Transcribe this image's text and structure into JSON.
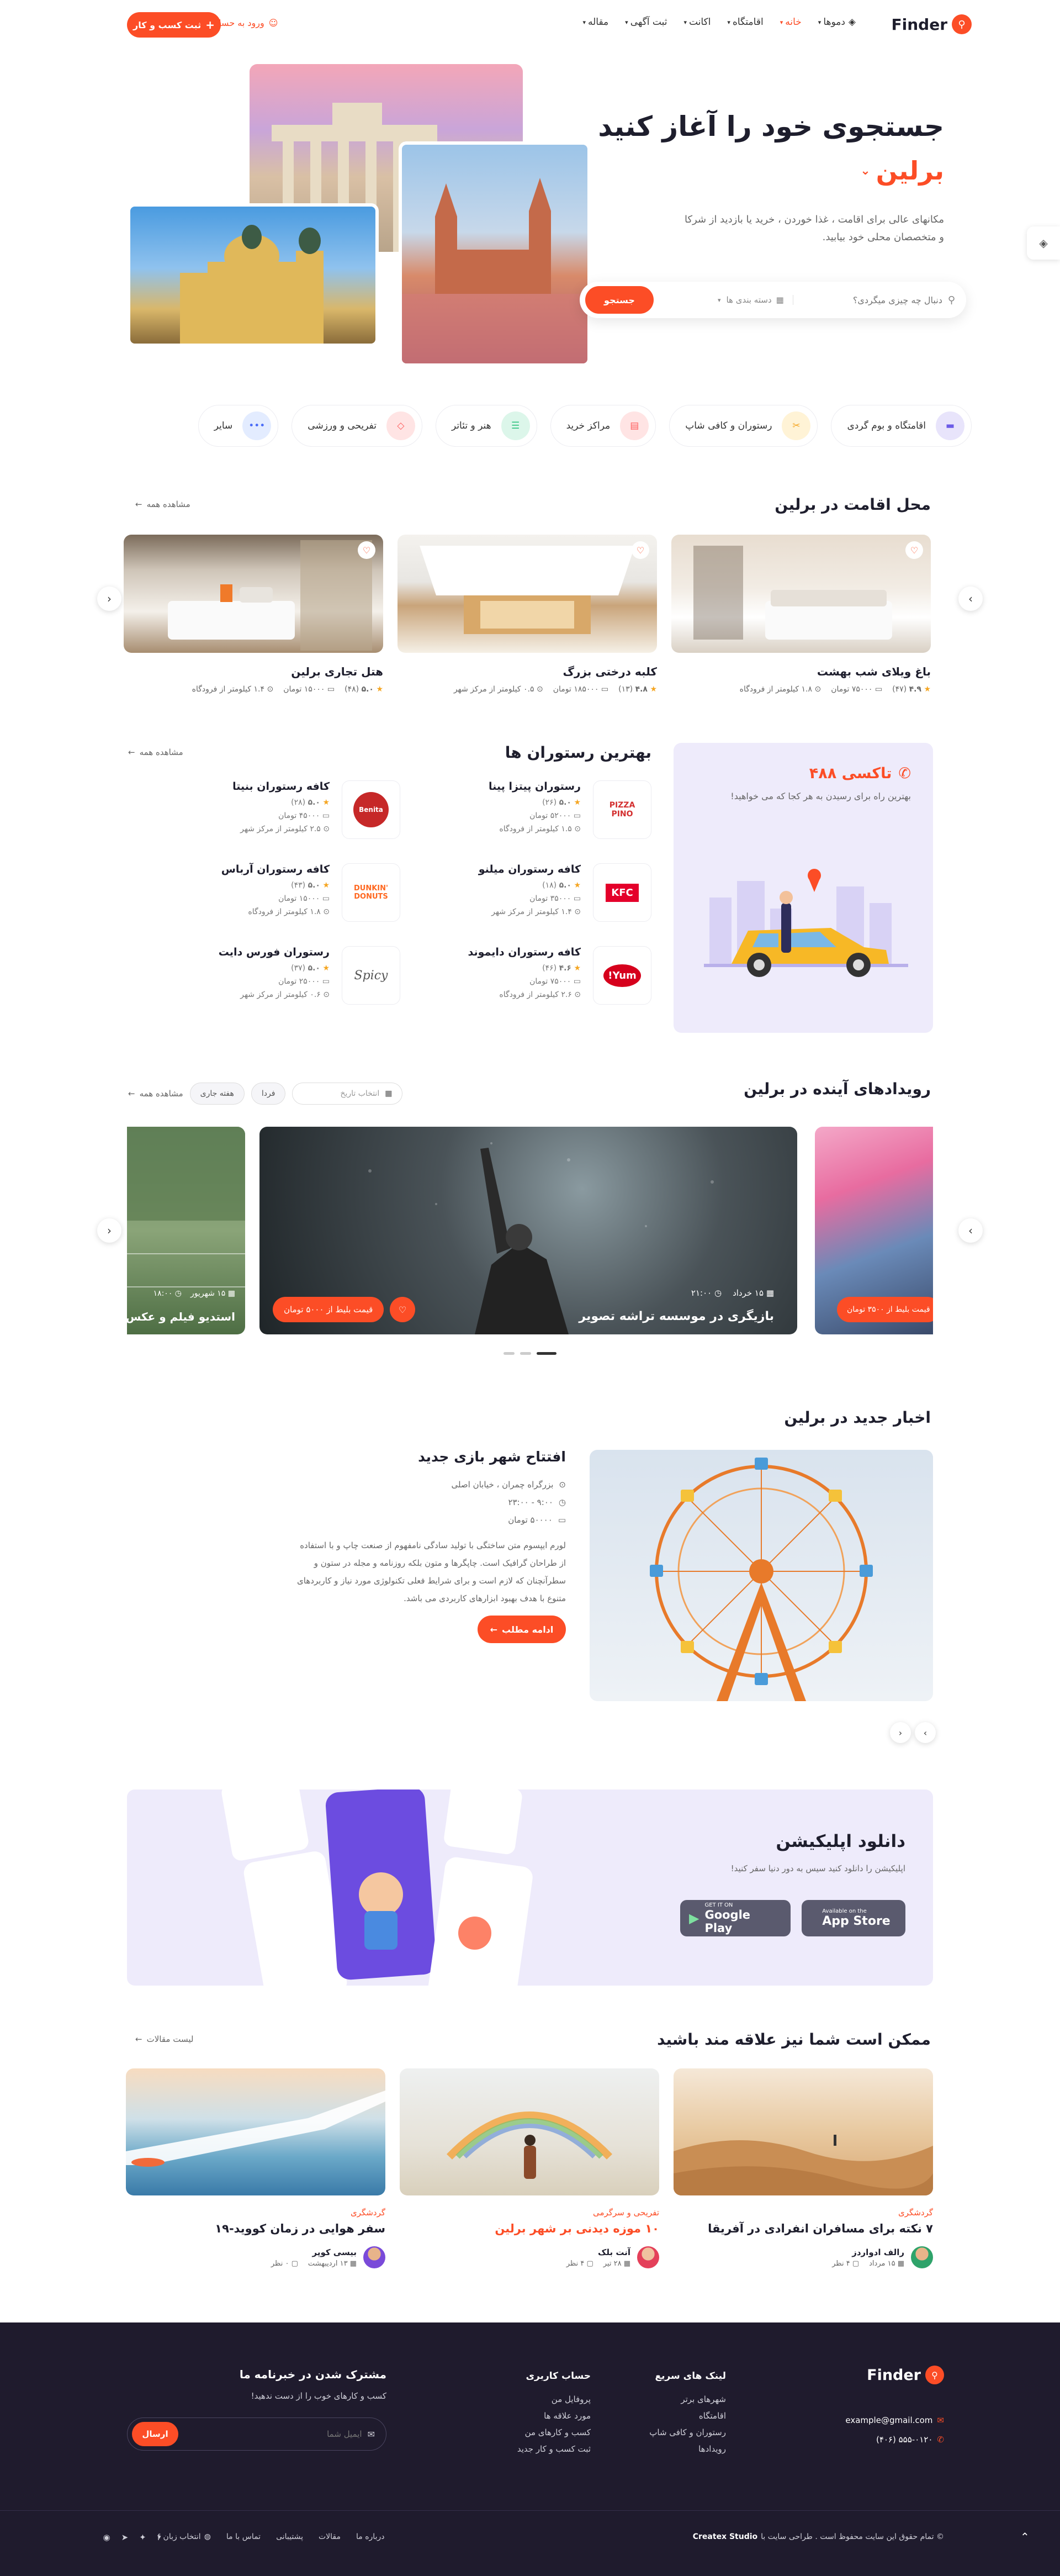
{
  "header": {
    "logo": "Finder",
    "nav": [
      "دموها",
      "خانه",
      "اقامتگاه",
      "اکانت",
      "ثبت آگهی",
      "مقاله"
    ],
    "login": "ورود به حساب کاربری",
    "register": "ثبت کسب و کار"
  },
  "hero": {
    "title": "جستجوی خود را آغاز کنید",
    "city": "برلین",
    "desc": "مکانهای عالی برای اقامت ، غذا خوردن ، خرید یا بازدید از شرکا و متخصصان محلی خود بیابید.",
    "search_placeholder": "دنبال چه چیزی میگردی؟",
    "category_select": "دسته بندی ها",
    "search_button": "جستجو"
  },
  "categories": [
    {
      "label": "اقامتگاه و بوم گردی",
      "color": "#e8e4fb",
      "fg": "#6c5ce7",
      "icon": "bed-icon",
      "glyph": "▬"
    },
    {
      "label": "رستوران و کافی شاپ",
      "color": "#fff3d6",
      "fg": "#f5a623",
      "icon": "utensils-icon",
      "glyph": "✂"
    },
    {
      "label": "مراکز خرید",
      "color": "#ffe4e4",
      "fg": "#ff5a5a",
      "icon": "shopping-bag-icon",
      "glyph": "▤"
    },
    {
      "label": "هنر و تئاتر",
      "color": "#dcf6ea",
      "fg": "#2ec27e",
      "icon": "theater-icon",
      "glyph": "☰"
    },
    {
      "label": "تفریحی و ورزشی",
      "color": "#ffe4e4",
      "fg": "#ff5a5a",
      "icon": "ticket-icon",
      "glyph": "◇"
    },
    {
      "label": "سایر",
      "color": "#e3ecff",
      "fg": "#4a6cf7",
      "icon": "more-icon",
      "glyph": "•••"
    }
  ],
  "stay": {
    "title": "محل اقامت در برلین",
    "view_all": "مشاهده همه",
    "items": [
      {
        "name": "باغ ویلای شب بهشت",
        "rating": "۴.۹",
        "reviews": "(۴۷)",
        "price": "۷۵۰۰۰ تومان",
        "distance": "۱.۸ کیلومتر از فرودگاه"
      },
      {
        "name": "کلبه درختی بزرگ",
        "rating": "۴.۸",
        "reviews": "(۱۳)",
        "price": "۱۸۵۰۰۰ تومان",
        "distance": "۰.۵ کیلومتر از مرکز شهر"
      },
      {
        "name": "هتل تجاری برلین",
        "rating": "۵.۰",
        "reviews": "(۴۸)",
        "price": "۱۵۰۰۰ تومان",
        "distance": "۱.۴ کیلومتر از فرودگاه"
      }
    ]
  },
  "taxi": {
    "name": "تاکسی ۴۸۸",
    "desc": "بهترین راه برای رسیدن به هر کجا که می خواهید!"
  },
  "restaurants": {
    "title": "بهترین رستوران ها",
    "view_all": "مشاهده همه",
    "items": [
      {
        "name": "رستوران پیتزا پینا",
        "rating": "۵.۰",
        "reviews": "(۲۶)",
        "price": "۵۲۰۰۰ تومان",
        "loc": "۱.۵ کیلومتر از فرودگاه",
        "logo": "PIZZA PINO",
        "logo_color": "#d32f2f"
      },
      {
        "name": "کافه رستوران بنیتا",
        "rating": "۵.۰",
        "reviews": "(۲۸)",
        "price": "۴۵۰۰۰ تومان",
        "loc": "۲.۵ کیلومتر از مرکز شهر",
        "logo": "Benita",
        "logo_color": "#c62828"
      },
      {
        "name": "کافه رستوران میلنو",
        "rating": "۵.۰",
        "reviews": "(۱۸)",
        "price": "۳۵۰۰۰ تومان",
        "loc": "۱.۴ کیلومتر از مرکز شهر",
        "logo": "KFC",
        "logo_color": "#e4002b"
      },
      {
        "name": "کافه رستوران آرباس",
        "rating": "۵.۰",
        "reviews": "(۴۳)",
        "price": "۱۵۰۰۰ تومان",
        "loc": "۱.۸ کیلومتر از فرودگاه",
        "logo": "DUNKIN' DONUTS",
        "logo_color": "#ff671f"
      },
      {
        "name": "کافه رستوران دایموند",
        "rating": "۴.۶",
        "reviews": "(۴۶)",
        "price": "۷۵۰۰۰ تومان",
        "loc": "۲.۶ کیلومتر از فرودگاه",
        "logo": "Yum!",
        "logo_color": "#d6001c"
      },
      {
        "name": "رستوران فورس دایت",
        "rating": "۵.۰",
        "reviews": "(۳۷)",
        "price": "۲۵۰۰۰ تومان",
        "loc": "۰.۶ کیلومتر از مرکز شهر",
        "logo": "Spicy",
        "logo_color": "#555"
      }
    ]
  },
  "events": {
    "title": "رویدادهای آینده در برلین",
    "filters": [
      "انتخاب تاریخ",
      "فردا",
      "هفته جاری",
      "مشاهده همه"
    ],
    "main": {
      "title": "بازیگری در موسسه تراشه تصویر",
      "date": "۱۵ خرداد",
      "time": "۲۱:۰۰",
      "price": "قیمت بلیط از ۵۰۰۰ تومان"
    },
    "left": {
      "title": "استدیو فیلم و عکس",
      "date": "۱۵ شهریور",
      "time": "۱۸:۰۰"
    },
    "right": {
      "price": "قیمت بلیط از ۳۵۰۰ تومان"
    }
  },
  "news": {
    "section_title": "اخبار جدید در برلین",
    "title": "افتتاح شهر بازی جدید",
    "location": "بزرگراه چمران ، خیابان اصلی",
    "hours": "۹:۰۰ - ۲۳:۰۰",
    "price": "۵۰۰۰۰ تومان",
    "body": "لورم ایپسوم متن ساختگی با تولید سادگی نامفهوم از صنعت چاپ و با استفاده از طراحان گرافیک است. چاپگرها و متون بلکه روزنامه و مجله در ستون و سطرآنچنان که لازم است و برای شرایط فعلی تکنولوژی مورد نیاز و کاربردهای متنوع با هدف بهبود ابزارهای کاربردی می باشد.",
    "button": "ادامه مطلب"
  },
  "app": {
    "title": "دانلود اپلیکیشن",
    "desc": "اپلیکیشن را دانلود کنید سیس به دور دنیا سفر کنید!",
    "google_small": "GET IT ON",
    "google": "Google Play",
    "apple_small": "Available on the",
    "apple": "App Store"
  },
  "blog": {
    "title": "ممکن است شما نیز علاقه مند باشید",
    "list_link": "لیست مقالات",
    "items": [
      {
        "cat": "گردشگری",
        "title": "۷ نکته برای مسافران انفرادی در آفریقا",
        "author": "رالف ادواردز",
        "date": "۱۵ مرداد",
        "comments": "۴ نظر",
        "cat_color": "#fc4d26"
      },
      {
        "cat": "تفریحی و سرگرمی",
        "title": "۱۰ موزه دیدنی بر شهر برلین",
        "author": "آنت بلک",
        "date": "۲۸ تیر",
        "comments": "۴ نظر",
        "cat_color": "#fc4d26"
      },
      {
        "cat": "گردشگری",
        "title": "سفر هوایی در زمان کووید-۱۹",
        "author": "بیسی کوپر",
        "date": "۱۳ اردیبهشت",
        "comments": "۰ نظر",
        "cat_color": "#fc4d26"
      }
    ]
  },
  "footer": {
    "logo": "Finder",
    "email": "example@gmail.com",
    "phone": "۵۵۵-۰۱۲۰ (۴۰۶)",
    "quick_title": "لینک های سریع",
    "quick": [
      "شهرهای برتر",
      "اقامتگاه",
      "رستوران و کافی شاپ",
      "رویدادها"
    ],
    "account_title": "حساب کاربری",
    "account": [
      "پروفایل من",
      "مورد علاقه ها",
      "کسب و کارهای من",
      "ثبت کسب و کار جدید"
    ],
    "newsletter_title": "مشترک شدن در خبرنامه ما",
    "newsletter_desc": "کسب و کارهای خوب را از دست ندهید!",
    "newsletter_placeholder": "ایمیل شما",
    "newsletter_button": "ارسال",
    "copyright": "© تمام حقوق این سایت محفوظ است . طراحی سایت با",
    "brand": "Createx Studio",
    "links": [
      "درباره ما",
      "مقالات",
      "پشتیبانی",
      "تماس با ما"
    ],
    "lang": "انتخاب زبان"
  }
}
